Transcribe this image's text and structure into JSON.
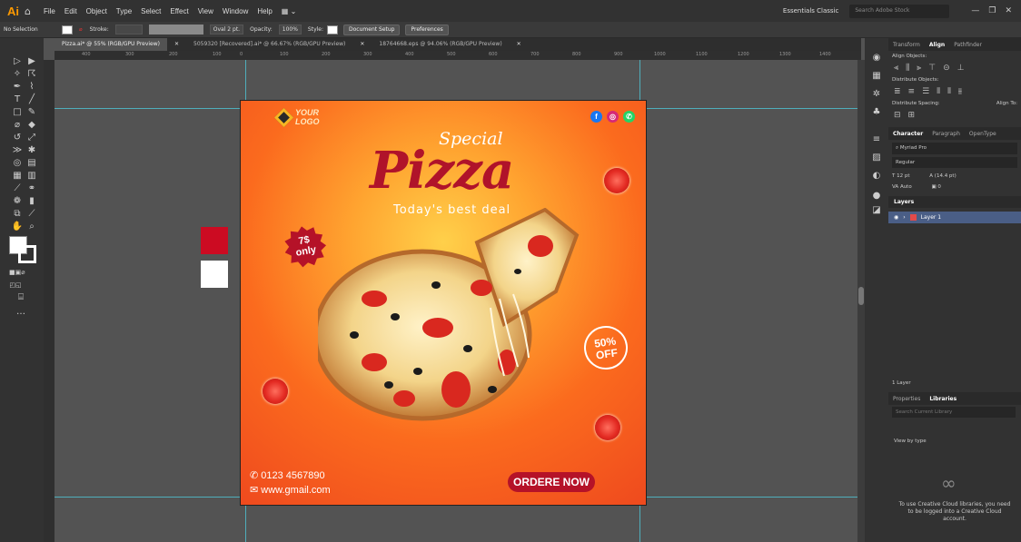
{
  "app": {
    "logo": "Ai",
    "menus": [
      "File",
      "Edit",
      "Object",
      "Type",
      "Select",
      "Effect",
      "View",
      "Window",
      "Help"
    ]
  },
  "workspace": {
    "name": "Essentials Classic",
    "search_placeholder": "Search Adobe Stock"
  },
  "control": {
    "selection": "No Selection",
    "stroke_label": "Stroke:",
    "brush": "Oval 2 pt.",
    "opacity_label": "Opacity:",
    "opacity_value": "100%",
    "style_label": "Style:",
    "doc_setup": "Document Setup",
    "preferences": "Preferences"
  },
  "doc_tabs": [
    "Pizza.ai* @ 55% (RGB/GPU Preview)",
    "5059320 [Recovered].ai* @ 66.67% (RGB/GPU Preview)",
    "18764668.eps @ 94.06% (RGB/GPU Preview)"
  ],
  "ruler_ticks": [
    "400",
    "300",
    "200",
    "100",
    "0",
    "100",
    "200",
    "300",
    "400",
    "500",
    "600",
    "700",
    "800",
    "900",
    "1000",
    "1100",
    "1200",
    "1300",
    "1400"
  ],
  "panel": {
    "tabs": [
      "Transform",
      "Align",
      "Pathfinder"
    ],
    "align_objects": "Align Objects:",
    "distribute_objects": "Distribute Objects:",
    "distribute_spacing": "Distribute Spacing:",
    "align_to": "Align To:",
    "char_tabs": [
      "Character",
      "Paragraph",
      "OpenType"
    ],
    "font": "Myriad Pro",
    "font_style": "Regular",
    "font_size": "12 pt",
    "leading": "(14.4 pt)",
    "kerning": "Auto",
    "tracking": "0",
    "layers_title": "Layers",
    "layer_name": "Layer 1",
    "layer_count": "1 Layer",
    "bottom_tabs": [
      "Properties",
      "Libraries"
    ],
    "search_libs": "Search Current Library",
    "view_by": "View by type",
    "login_msg": "To use Creative Cloud libraries, you need to be logged into a Creative Cloud account."
  },
  "poster": {
    "logo_line1": "YOUR",
    "logo_line2": "LOGO",
    "special": "Special",
    "title": "Pizza",
    "tagline": "Today's best deal",
    "price_line1": "7$",
    "price_line2": "only",
    "off_line1": "50%",
    "off_line2": "OFF",
    "phone": "0123 4567890",
    "web": "www.gmail.com",
    "cta": "ORDERE NOW"
  },
  "colors": {
    "accent_red": "#b51228",
    "guide": "#4fd6e8",
    "layer_highlight": "#4a5e86"
  }
}
